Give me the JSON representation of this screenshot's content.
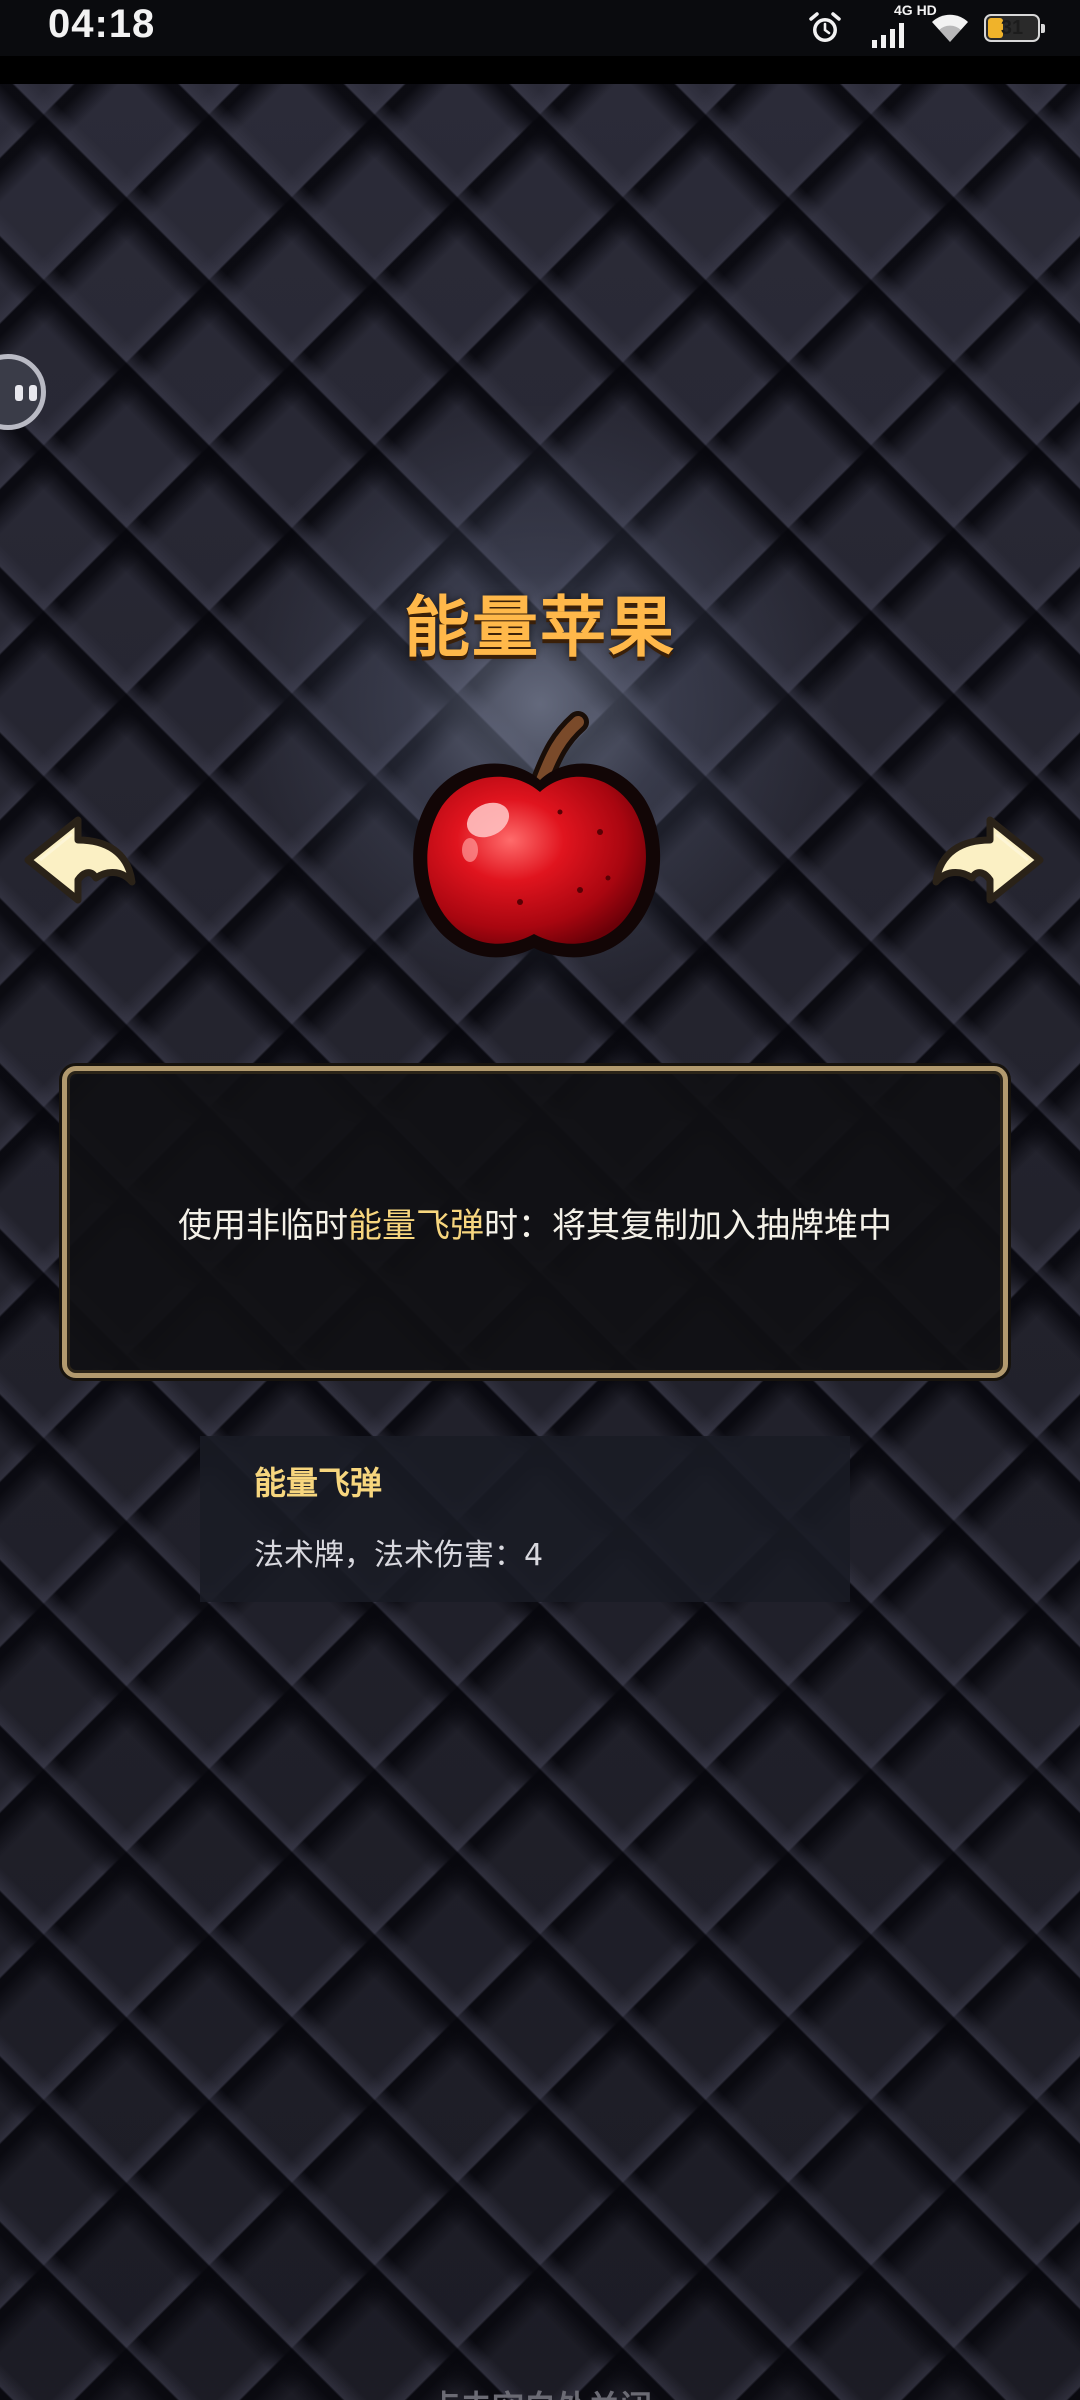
{
  "status_bar": {
    "time": "04:18",
    "network_label": "4G HD",
    "battery_level": "31",
    "icons": [
      "alarm-icon",
      "signal-icon",
      "wifi-icon",
      "battery-icon"
    ]
  },
  "item": {
    "title": "能量苹果",
    "image_icon": "red-apple-icon"
  },
  "navigation": {
    "prev_icon": "arrow-left-icon",
    "next_icon": "arrow-right-icon"
  },
  "description": {
    "prefix": "使用非临时",
    "highlight": "能量飞弹",
    "suffix": "时：将其复制加入抽牌堆中"
  },
  "keyword": {
    "name": "能量飞弹",
    "detail": "法术牌，法术伤害：4"
  },
  "footer": {
    "close_hint": "点击空白处关闭"
  },
  "colors": {
    "title": "#ffb84a",
    "highlight": "#f7d67e",
    "border": "#b29a6e",
    "background": "#24242f"
  }
}
